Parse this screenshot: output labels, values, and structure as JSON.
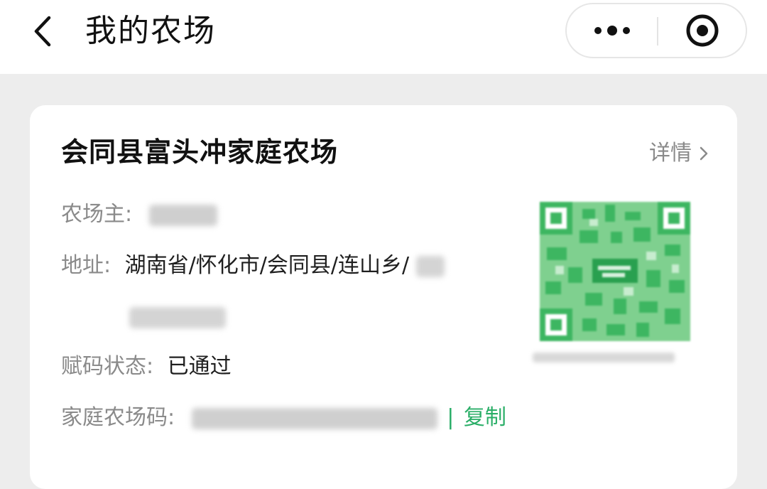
{
  "nav": {
    "back_icon": "chevron-left-icon",
    "title": "我的农场",
    "more_icon": "more-dots-icon",
    "close_icon": "target-close-icon"
  },
  "farm": {
    "name": "会同县富头冲家庭农场",
    "detail_label": "详情",
    "detail_icon": "chevron-right-icon",
    "owner_label": "农场主:",
    "address_label": "地址:",
    "address_value": "湖南省/怀化市/会同县/连山乡/",
    "status_label": "赋码状态:",
    "status_value": "已通过",
    "code_label": "家庭农场码:",
    "code_separator": "|",
    "copy_label": "复制"
  },
  "colors": {
    "accent_green": "#2aae67",
    "qr_green": "#3db661",
    "label_gray": "#8a8a8a"
  }
}
